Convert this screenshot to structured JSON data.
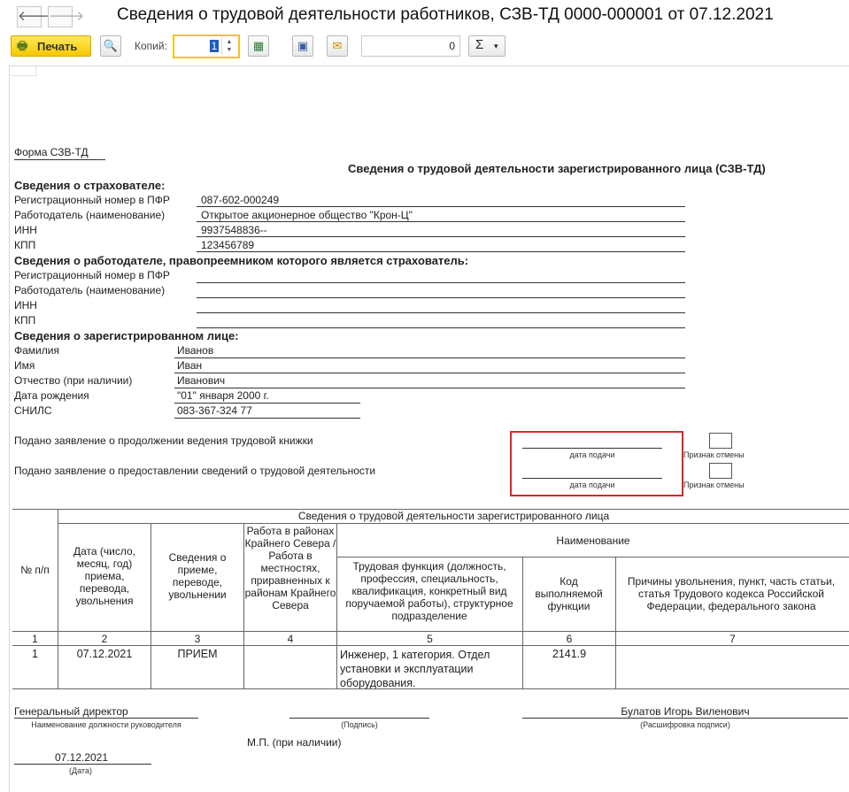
{
  "window": {
    "title": "Сведения о трудовой деятельности работников, СЗВ-ТД 0000-000001 от 07.12.2021",
    "back_icon": "arrow-left-icon",
    "forward_icon": "arrow-right-icon"
  },
  "toolbar": {
    "print_label": "Печать",
    "copies_label": "Копий:",
    "copies_value": "1",
    "sum_value": "0",
    "sum_symbol": "Σ",
    "sum_dropdown": "▾"
  },
  "form": {
    "form_name": "Форма СЗВ-ТД",
    "heading": "Сведения о трудовой деятельности зарегистрированного лица (СЗВ-ТД)",
    "insurer_section": "Сведения о страхователе:",
    "insurer": [
      {
        "label": "Регистрационный номер в ПФР",
        "value": "087-602-000249"
      },
      {
        "label": "Работодатель (наименование)",
        "value": "Открытое акционерное общество \"Крон-Ц\""
      },
      {
        "label": "ИНН",
        "value": "9937548836--"
      },
      {
        "label": "КПП",
        "value": "123456789"
      }
    ],
    "successor_section": "Сведения о работодателе, правопреемником которого является страхователь:",
    "successor": [
      {
        "label": "Регистрационный номер в ПФР",
        "value": ""
      },
      {
        "label": "Работодатель (наименование)",
        "value": ""
      },
      {
        "label": "ИНН",
        "value": ""
      },
      {
        "label": "КПП",
        "value": ""
      }
    ],
    "person_section": "Сведения о зарегистрированном лице:",
    "person": [
      {
        "label": "Фамилия",
        "value": "Иванов"
      },
      {
        "label": "Имя",
        "value": "Иван"
      },
      {
        "label": "Отчество (при наличии)",
        "value": "Иванович"
      },
      {
        "label": "Дата рождения",
        "value": "\"01\" января 2000 г."
      },
      {
        "label": "СНИЛС",
        "value": "083-367-324 77"
      }
    ],
    "application1": "Подано заявление о продолжении ведения трудовой книжки",
    "application2": "Подано заявление о предоставлении сведений о трудовой деятельности",
    "date_caption": "дата подачи",
    "cancel_caption": "Признак отмены"
  },
  "table": {
    "group_header": "Сведения о трудовой деятельности зарегистрированного лица",
    "name_header": "Наименование",
    "columns": [
      "№ п/п",
      "Дата (число, месяц, год) приема, перевода, увольнения",
      "Сведения о приеме, переводе, увольнении",
      "Работа в районах Крайнего Севера / Работа в местностях, приравненных к районам Крайнего Севера",
      "Трудовая функция (должность, профессия, специальность, квалификация, конкретный вид поручаемой работы), структурное подразделение",
      "Код выполняемой функции",
      "Причины увольнения, пункт, часть статьи, статья Трудового кодекса Российской Федерации, федерального закона"
    ],
    "numbers": [
      "1",
      "2",
      "3",
      "4",
      "5",
      "6",
      "7"
    ],
    "rows": [
      [
        "1",
        "07.12.2021",
        "ПРИЕМ",
        "",
        "Инженер, 1 категория. Отдел установки и эксплуатации оборудования.",
        "2141.9",
        ""
      ]
    ]
  },
  "signature": {
    "position": "Генеральный директор",
    "position_caption": "Наименование должности руководителя",
    "sign_caption": "(Подпись)",
    "name": "Булатов Игорь Виленович",
    "name_caption": "(Расшифровка подписи)",
    "stamp": "М.П. (при наличии)",
    "date": "07.12.2021",
    "date_caption": "(Дата)"
  }
}
